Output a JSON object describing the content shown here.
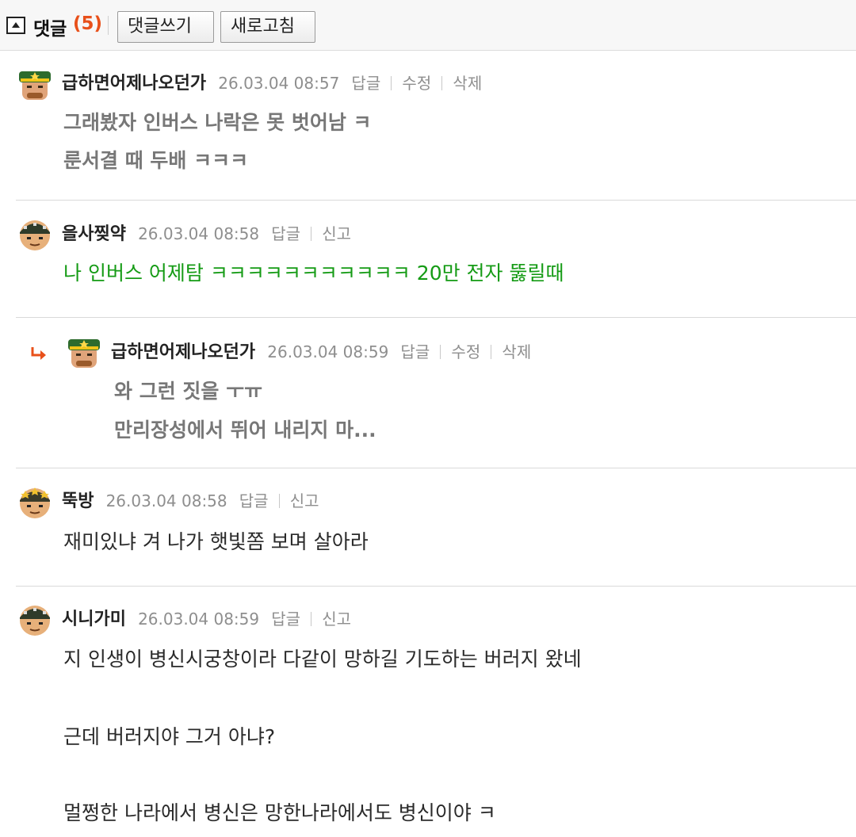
{
  "toolbar": {
    "title": "댓글",
    "count": "(5)",
    "write_label": "댓글쓰기",
    "refresh_label": "새로고침"
  },
  "comments": [
    {
      "nickname": "급하면어제나오던가",
      "date": "26.03.04 08:57",
      "actions": [
        "답글",
        "수정",
        "삭제"
      ],
      "lines": [
        "그래봤자 인버스 나락은 못 벗어남 ㅋ",
        "룬서결 때 두배 ㅋㅋㅋ"
      ]
    },
    {
      "nickname": "을사찢약",
      "date": "26.03.04 08:58",
      "actions": [
        "답글",
        "신고"
      ],
      "lines": [
        "나 인버스 어제탐 ㅋㅋㅋㅋㅋㅋㅋㅋㅋㅋㅋ 20만 전자 뚫릴때"
      ]
    },
    {
      "nickname": "급하면어제나오던가",
      "date": "26.03.04 08:59",
      "actions": [
        "답글",
        "수정",
        "삭제"
      ],
      "lines": [
        "와 그런 짓을 ㅜㅠ",
        "만리장성에서 뛰어 내리지 마..."
      ]
    },
    {
      "nickname": "뚝방",
      "date": "26.03.04 08:58",
      "actions": [
        "답글",
        "신고"
      ],
      "lines": [
        "재미있냐 겨 나가 햇빛쫌 보며 살아라"
      ]
    },
    {
      "nickname": "시니가미",
      "date": "26.03.04 08:59",
      "actions": [
        "답글",
        "신고"
      ],
      "lines": [
        "지 인생이 병신시궁창이라 다같이 망하길 기도하는 버러지 왔네",
        "근데 버러지야 그거 아냐?",
        "멀쩡한 나라에서 병신은 망한나라에서도 병신이야 ㅋ"
      ]
    }
  ],
  "colors": {
    "accent_count": "#e8501a",
    "green_text": "#159b15",
    "reply_arrow": "#e8501a"
  },
  "icons": [
    "collapse-toggle-icon",
    "reply-arrow-icon",
    "avatar-general-icon",
    "avatar-soldier-icon"
  ]
}
